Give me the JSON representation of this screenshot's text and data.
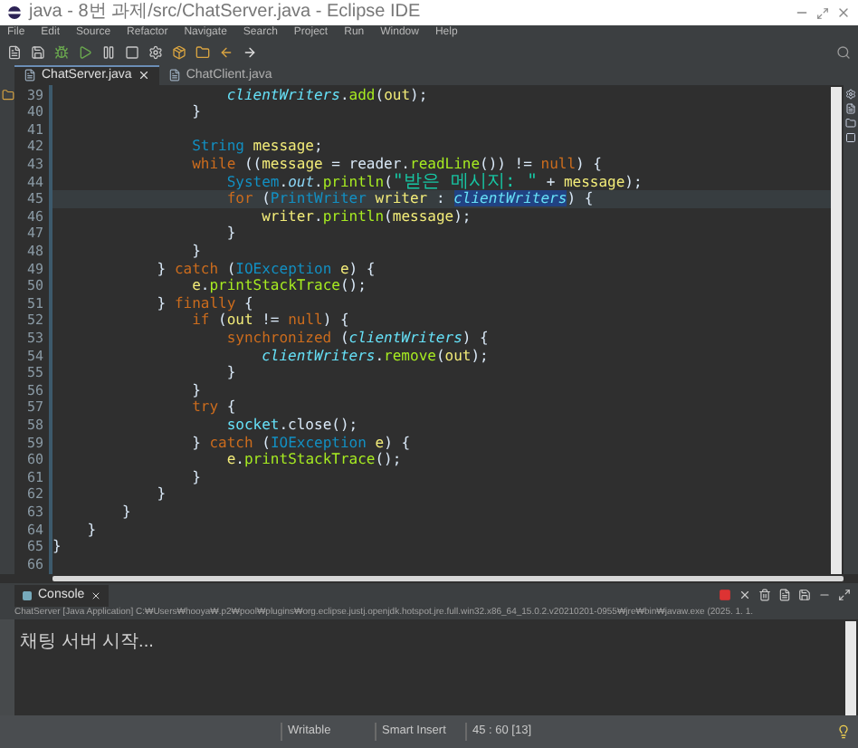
{
  "window": {
    "title": "java - 8번 과제/src/ChatServer.java - Eclipse IDE"
  },
  "menu": [
    "File",
    "Edit",
    "Source",
    "Refactor",
    "Navigate",
    "Search",
    "Project",
    "Run",
    "Window",
    "Help"
  ],
  "editor_tabs": [
    {
      "label": "ChatServer.java",
      "selected": true
    },
    {
      "label": "ChatClient.java",
      "selected": false
    }
  ],
  "editor": {
    "lines": [
      {
        "number": "39",
        "current": false,
        "tokens": [
          {
            "kind": "field",
            "text": "                    clientWriters"
          },
          {
            "kind": "plain",
            "text": "."
          },
          {
            "kind": "method",
            "text": "add"
          },
          {
            "kind": "plain",
            "text": "("
          },
          {
            "kind": "local",
            "text": "out"
          },
          {
            "kind": "plain",
            "text": ");"
          }
        ]
      },
      {
        "number": "40",
        "current": false,
        "tokens": [
          {
            "kind": "plain",
            "text": "                }"
          }
        ]
      },
      {
        "number": "41",
        "current": false
      },
      {
        "number": "42",
        "current": false,
        "tokens": [
          {
            "kind": "type",
            "text": "                String "
          },
          {
            "kind": "local",
            "text": "message"
          },
          {
            "kind": "plain",
            "text": ";"
          }
        ]
      },
      {
        "number": "43",
        "current": false,
        "tokens": [
          {
            "kind": "keyword",
            "text": "                while"
          },
          {
            "kind": "plain",
            "text": " (("
          },
          {
            "kind": "local",
            "text": "message"
          },
          {
            "kind": "plain",
            "text": " = reader."
          },
          {
            "kind": "method",
            "text": "readLine"
          },
          {
            "kind": "plain",
            "text": "()) != "
          },
          {
            "kind": "keyword",
            "text": "null"
          },
          {
            "kind": "plain",
            "text": ") {"
          }
        ]
      },
      {
        "number": "44",
        "current": false,
        "tokens": [
          {
            "kind": "type",
            "text": "                    System"
          },
          {
            "kind": "plain",
            "text": "."
          },
          {
            "kind": "static",
            "text": "out"
          },
          {
            "kind": "plain",
            "text": "."
          },
          {
            "kind": "method",
            "text": "println"
          },
          {
            "kind": "plain",
            "text": "("
          },
          {
            "kind": "string",
            "text": "\"받은 메시지: \""
          },
          {
            "kind": "plain",
            "text": " + "
          },
          {
            "kind": "local",
            "text": "message"
          },
          {
            "kind": "plain",
            "text": ");"
          }
        ]
      },
      {
        "number": "45",
        "current": true,
        "tokens": [
          {
            "kind": "keyword",
            "text": "                    for"
          },
          {
            "kind": "plain",
            "text": " ("
          },
          {
            "kind": "type",
            "text": "PrintWriter "
          },
          {
            "kind": "local",
            "text": "writer"
          },
          {
            "kind": "plain",
            "text": " : "
          },
          {
            "kind": "field",
            "text": "clientWriters",
            "selected": true
          },
          {
            "kind": "plain",
            "text": ") {"
          }
        ]
      },
      {
        "number": "46",
        "current": false,
        "tokens": [
          {
            "kind": "local",
            "text": "                        writer"
          },
          {
            "kind": "plain",
            "text": "."
          },
          {
            "kind": "method",
            "text": "println"
          },
          {
            "kind": "plain",
            "text": "("
          },
          {
            "kind": "local",
            "text": "message"
          },
          {
            "kind": "plain",
            "text": ");"
          }
        ]
      },
      {
        "number": "47",
        "current": false,
        "tokens": [
          {
            "kind": "plain",
            "text": "                    }"
          }
        ]
      },
      {
        "number": "48",
        "current": false,
        "tokens": [
          {
            "kind": "plain",
            "text": "                }"
          }
        ]
      },
      {
        "number": "49",
        "current": false,
        "tokens": [
          {
            "kind": "plain",
            "text": "            } "
          },
          {
            "kind": "keyword",
            "text": "catch"
          },
          {
            "kind": "plain",
            "text": " ("
          },
          {
            "kind": "type",
            "text": "IOException "
          },
          {
            "kind": "local",
            "text": "e"
          },
          {
            "kind": "plain",
            "text": ") {"
          }
        ]
      },
      {
        "number": "50",
        "current": false,
        "tokens": [
          {
            "kind": "local",
            "text": "                e"
          },
          {
            "kind": "plain",
            "text": "."
          },
          {
            "kind": "method",
            "text": "printStackTrace"
          },
          {
            "kind": "plain",
            "text": "();"
          }
        ]
      },
      {
        "number": "51",
        "current": false,
        "tokens": [
          {
            "kind": "plain",
            "text": "            } "
          },
          {
            "kind": "keyword",
            "text": "finally"
          },
          {
            "kind": "plain",
            "text": " {"
          }
        ]
      },
      {
        "number": "52",
        "current": false,
        "tokens": [
          {
            "kind": "keyword",
            "text": "                if"
          },
          {
            "kind": "plain",
            "text": " ("
          },
          {
            "kind": "local",
            "text": "out"
          },
          {
            "kind": "plain",
            "text": " != "
          },
          {
            "kind": "keyword",
            "text": "null"
          },
          {
            "kind": "plain",
            "text": ") {"
          }
        ]
      },
      {
        "number": "53",
        "current": false,
        "tokens": [
          {
            "kind": "keyword",
            "text": "                    synchronized"
          },
          {
            "kind": "plain",
            "text": " ("
          },
          {
            "kind": "field",
            "text": "clientWriters"
          },
          {
            "kind": "plain",
            "text": ") {"
          }
        ]
      },
      {
        "number": "54",
        "current": false,
        "tokens": [
          {
            "kind": "field",
            "text": "                        clientWriters"
          },
          {
            "kind": "plain",
            "text": "."
          },
          {
            "kind": "method",
            "text": "remove"
          },
          {
            "kind": "plain",
            "text": "("
          },
          {
            "kind": "local",
            "text": "out"
          },
          {
            "kind": "plain",
            "text": ");"
          }
        ]
      },
      {
        "number": "55",
        "current": false,
        "tokens": [
          {
            "kind": "plain",
            "text": "                    }"
          }
        ]
      },
      {
        "number": "56",
        "current": false,
        "tokens": [
          {
            "kind": "plain",
            "text": "                }"
          }
        ]
      },
      {
        "number": "57",
        "current": false,
        "tokens": [
          {
            "kind": "keyword",
            "text": "                try"
          },
          {
            "kind": "plain",
            "text": " {"
          }
        ]
      },
      {
        "number": "58",
        "current": false,
        "tokens": [
          {
            "kind": "member",
            "text": "                    socket"
          },
          {
            "kind": "plain",
            "text": ".close"
          },
          {
            "kind": "plain",
            "text": "();"
          }
        ]
      },
      {
        "number": "59",
        "current": false,
        "tokens": [
          {
            "kind": "plain",
            "text": "                } "
          },
          {
            "kind": "keyword",
            "text": "catch"
          },
          {
            "kind": "plain",
            "text": " ("
          },
          {
            "kind": "type",
            "text": "IOException "
          },
          {
            "kind": "local",
            "text": "e"
          },
          {
            "kind": "plain",
            "text": ") {"
          }
        ]
      },
      {
        "number": "60",
        "current": false,
        "tokens": [
          {
            "kind": "local",
            "text": "                    e"
          },
          {
            "kind": "plain",
            "text": "."
          },
          {
            "kind": "method",
            "text": "printStackTrace"
          },
          {
            "kind": "plain",
            "text": "();"
          }
        ]
      },
      {
        "number": "61",
        "current": false,
        "tokens": [
          {
            "kind": "plain",
            "text": "                }"
          }
        ]
      },
      {
        "number": "62",
        "current": false,
        "tokens": [
          {
            "kind": "plain",
            "text": "            }"
          }
        ]
      },
      {
        "number": "63",
        "current": false,
        "tokens": [
          {
            "kind": "plain",
            "text": "        }"
          }
        ]
      },
      {
        "number": "64",
        "current": false,
        "tokens": [
          {
            "kind": "plain",
            "text": "    }"
          }
        ]
      },
      {
        "number": "65",
        "current": false,
        "tokens": [
          {
            "kind": "plain",
            "text": "}"
          }
        ]
      },
      {
        "number": "66",
        "current": false
      }
    ]
  },
  "console": {
    "tab": "Console",
    "process": "ChatServer [Java Application] C:₩Users₩hooya₩.p2₩pool₩plugins₩org.eclipse.justj.openjdk.hotspot.jre.full.win32.x86_64_15.0.2.v20210201-0955₩jre₩bin₩javaw.exe  (2025. 1. 1.",
    "output": "채팅 서버 시작..."
  },
  "status_bar": [
    "Writable",
    "Smart Insert",
    "45 : 60 [13]"
  ]
}
